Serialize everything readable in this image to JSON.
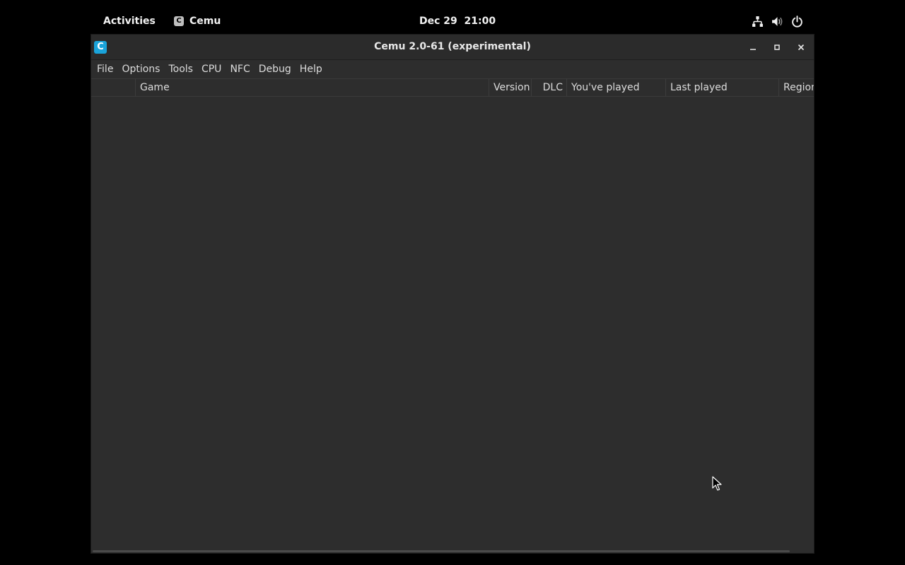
{
  "topbar": {
    "activities_label": "Activities",
    "app_name": "Cemu",
    "app_icon_letter": "C",
    "clock": "Dec 29  21:00",
    "tray_icons": [
      "network-icon",
      "volume-icon",
      "power-icon"
    ]
  },
  "window": {
    "title": "Cemu 2.0-61 (experimental)",
    "logo_letter": "C",
    "controls": [
      "minimize-icon",
      "maximize-icon",
      "close-icon"
    ]
  },
  "menubar": {
    "items": [
      "File",
      "Options",
      "Tools",
      "CPU",
      "NFC",
      "Debug",
      "Help"
    ]
  },
  "game_list": {
    "columns": [
      "",
      "Game",
      "Version",
      "DLC",
      "You've played",
      "Last played",
      "Region"
    ],
    "rows": []
  },
  "colors": {
    "desktop_bg": "#000000",
    "window_bg": "#2d2d2d",
    "text": "#dcdcdc",
    "logo_accent": "#1aa3d9"
  }
}
